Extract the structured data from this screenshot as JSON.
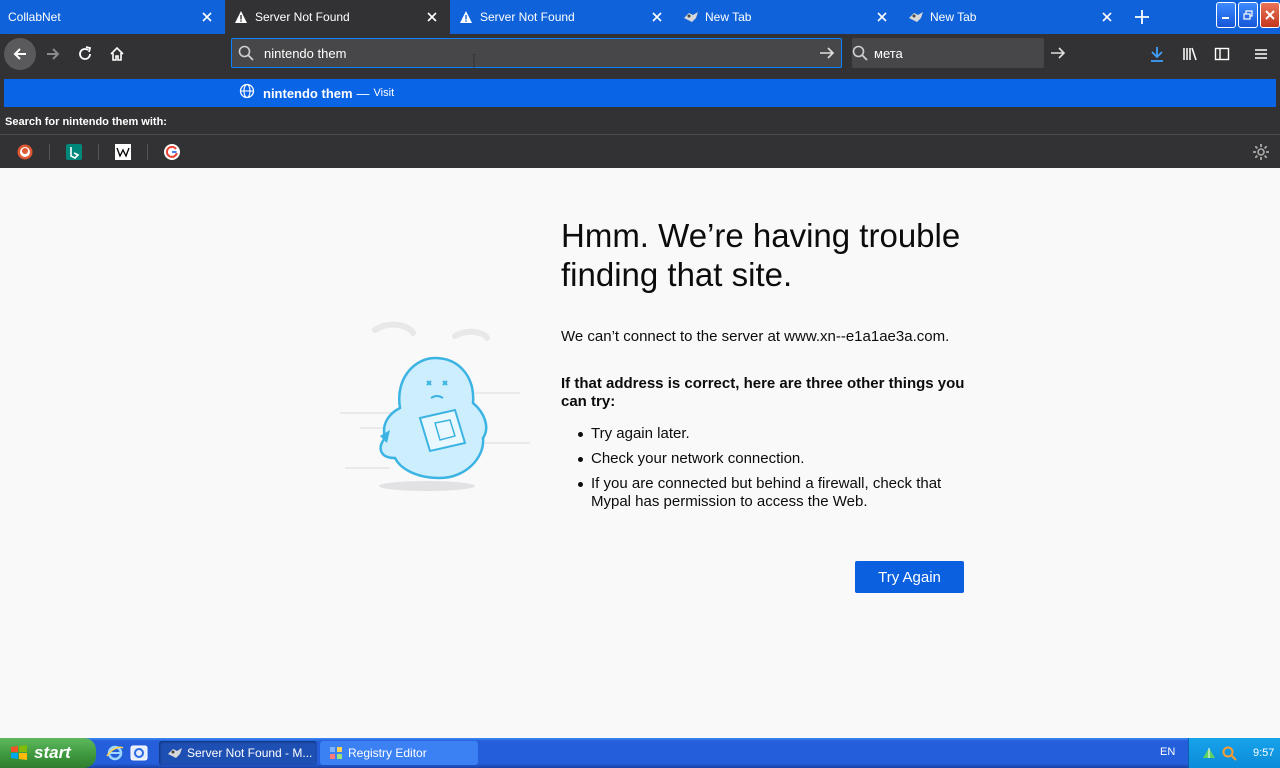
{
  "browser": {
    "tabs": [
      {
        "label": "CollabNet",
        "icon": "none",
        "active": false
      },
      {
        "label": "Server Not Found",
        "icon": "warning-icon",
        "active": true
      },
      {
        "label": "Server Not Found",
        "icon": "warning-icon",
        "active": false
      },
      {
        "label": "New Tab",
        "icon": "mypal-icon",
        "active": false
      },
      {
        "label": "New Tab",
        "icon": "mypal-icon",
        "active": false
      }
    ],
    "url_value": "nintendo them",
    "search_value": "мета"
  },
  "autocomplete": {
    "row_text": "nintendo them",
    "row_separator": "—",
    "row_action": "Visit",
    "search_with_label": "Search for nintendo them with:",
    "engines": [
      "duckduckgo",
      "bing",
      "wikipedia",
      "google"
    ]
  },
  "error_page": {
    "title": "Hmm. We’re having trouble finding that site.",
    "description": "We can’t connect to the server at www.xn--e1a1ae3a.com.",
    "subtitle": "If that address is correct, here are three other things you can try:",
    "tips": [
      "Try again later.",
      "Check your network connection.",
      "If you are connected but behind a firewall, check that Mypal has permission to access the Web."
    ],
    "button": "Try Again"
  },
  "taskbar": {
    "start_label": "start",
    "items": [
      {
        "label": "Server Not Found - M...",
        "active": true
      },
      {
        "label": "Registry Editor",
        "active": false
      }
    ],
    "language": "EN",
    "clock": "9:57"
  },
  "colors": {
    "tab_strip": "#0f62d9",
    "toolbar": "#323234",
    "accent": "#0a60df"
  }
}
